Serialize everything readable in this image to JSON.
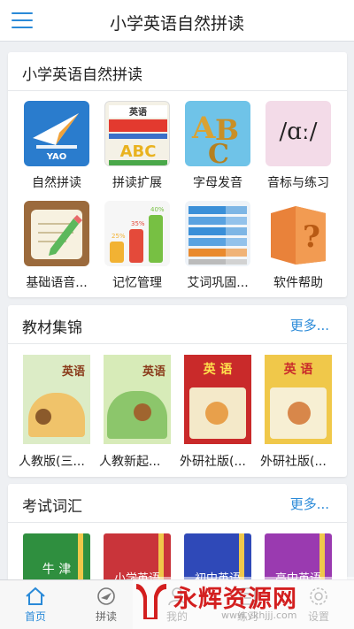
{
  "header": {
    "title": "小学英语自然拼读"
  },
  "section_main": {
    "title": "小学英语自然拼读",
    "items": [
      {
        "label": "自然拼读",
        "icon": "paper-plane-icon"
      },
      {
        "label": "拼读扩展",
        "icon": "phonics-book-icon"
      },
      {
        "label": "字母发音",
        "icon": "abc-letters-icon"
      },
      {
        "label": "音标与练习",
        "icon": "phonetic-symbol-icon",
        "symbol": "/ɑː/"
      },
      {
        "label": "基础语音...",
        "icon": "notebook-pencil-icon"
      },
      {
        "label": "记忆管理",
        "icon": "bar-chart-icon"
      },
      {
        "label": "艾词巩固...",
        "icon": "word-list-icon"
      },
      {
        "label": "软件帮助",
        "icon": "help-book-icon"
      }
    ]
  },
  "section_textbooks": {
    "title": "教材集锦",
    "more": "更多...",
    "items": [
      {
        "label": "人教版(三...",
        "cover_word": "英语"
      },
      {
        "label": "人教新起...",
        "cover_word": "英语"
      },
      {
        "label": "外研社版(...",
        "cover_word": "英 语"
      },
      {
        "label": "外研社版(...",
        "cover_word": "英 语"
      }
    ]
  },
  "section_exam": {
    "title": "考试词汇",
    "more": "更多...",
    "items": [
      {
        "label": "牛 津",
        "color": "#2f8f3f"
      },
      {
        "label": "小学英语",
        "color": "#c9343a"
      },
      {
        "label": "初中英语",
        "color": "#2f49b8"
      },
      {
        "label": "高中英语",
        "color": "#9a3ab0"
      }
    ]
  },
  "tabbar": {
    "items": [
      {
        "label": "首页",
        "active": true
      },
      {
        "label": "拼读",
        "active": false
      },
      {
        "label": "我的",
        "active": false
      },
      {
        "label": "练习",
        "active": false
      },
      {
        "label": "设置",
        "active": false
      }
    ]
  },
  "watermark": {
    "name": "永辉资源网",
    "url": "www.ykhjjj.com"
  },
  "colors": {
    "accent": "#2a8ad8",
    "background": "#eef0f3",
    "watermark_red": "#d31f1f"
  }
}
